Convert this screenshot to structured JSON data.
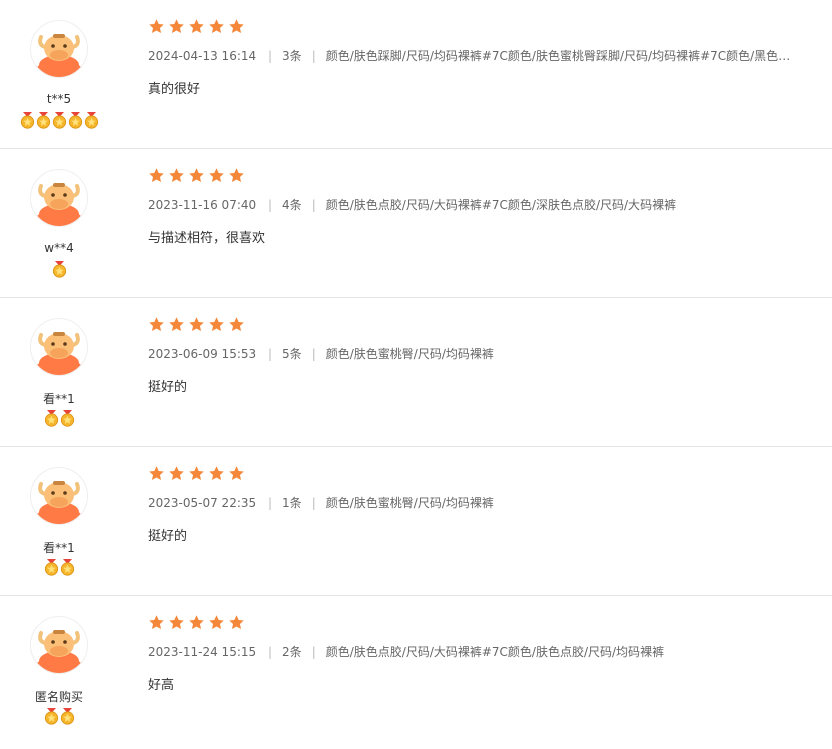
{
  "reviews": [
    {
      "username": "t**5",
      "medals": 5,
      "rating": 5,
      "date": "2024-04-13 16:14",
      "count": "3条",
      "sku": "颜色/肤色踩脚/尺码/均码裸裤#7C颜色/肤色蜜桃臀踩脚/尺码/均码裸裤#7C颜色/黑色踩...",
      "text": "真的很好"
    },
    {
      "username": "w**4",
      "medals": 1,
      "rating": 5,
      "date": "2023-11-16 07:40",
      "count": "4条",
      "sku": "颜色/肤色点胶/尺码/大码裸裤#7C颜色/深肤色点胶/尺码/大码裸裤",
      "text": "与描述相符，很喜欢"
    },
    {
      "username": "看**1",
      "medals": 2,
      "rating": 5,
      "date": "2023-06-09 15:53",
      "count": "5条",
      "sku": "颜色/肤色蜜桃臀/尺码/均码裸裤",
      "text": "挺好的"
    },
    {
      "username": "看**1",
      "medals": 2,
      "rating": 5,
      "date": "2023-05-07 22:35",
      "count": "1条",
      "sku": "颜色/肤色蜜桃臀/尺码/均码裸裤",
      "text": "挺好的"
    },
    {
      "username": "匿名购买",
      "medals": 2,
      "rating": 5,
      "date": "2023-11-24 15:15",
      "count": "2条",
      "sku": "颜色/肤色点胶/尺码/大码裸裤#7C颜色/肤色点胶/尺码/均码裸裤",
      "text": "好高"
    }
  ],
  "separator": "|",
  "colors": {
    "star": "#f5873a",
    "avatar_orange": "#ff7a45",
    "medal_gold": "#f7b52c",
    "medal_red": "#e8443a"
  },
  "icons": {
    "avatar": "bull-avatar-icon",
    "star": "star-icon",
    "medal": "medal-icon"
  }
}
